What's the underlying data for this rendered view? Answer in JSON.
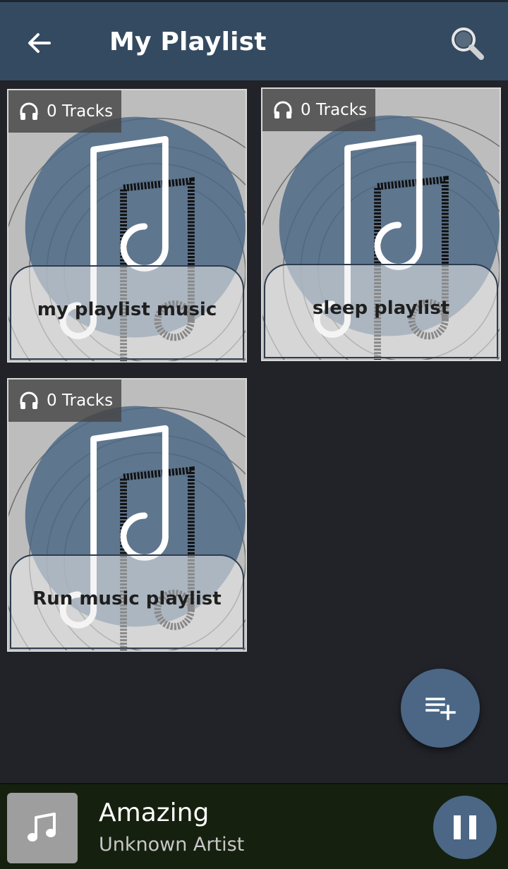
{
  "appbar": {
    "title": "My Playlist",
    "back_icon": "arrow-left-icon",
    "search_icon": "search-icon",
    "background": "#344a61"
  },
  "playlists": [
    {
      "tracks_label": "0 Tracks",
      "name": "my playlist music"
    },
    {
      "tracks_label": "0 Tracks",
      "name": "sleep playlist"
    },
    {
      "tracks_label": "0 Tracks",
      "name": "Run music playlist"
    }
  ],
  "fab": {
    "icon": "playlist-add-icon",
    "color": "#4b6785"
  },
  "now_playing": {
    "song": "Amazing",
    "artist": "Unknown Artist",
    "thumb_icon": "music-note-icon",
    "control_icon": "pause-icon"
  },
  "colors": {
    "background": "#212329",
    "accent": "#4b6785",
    "player_bar": "#15200f"
  }
}
